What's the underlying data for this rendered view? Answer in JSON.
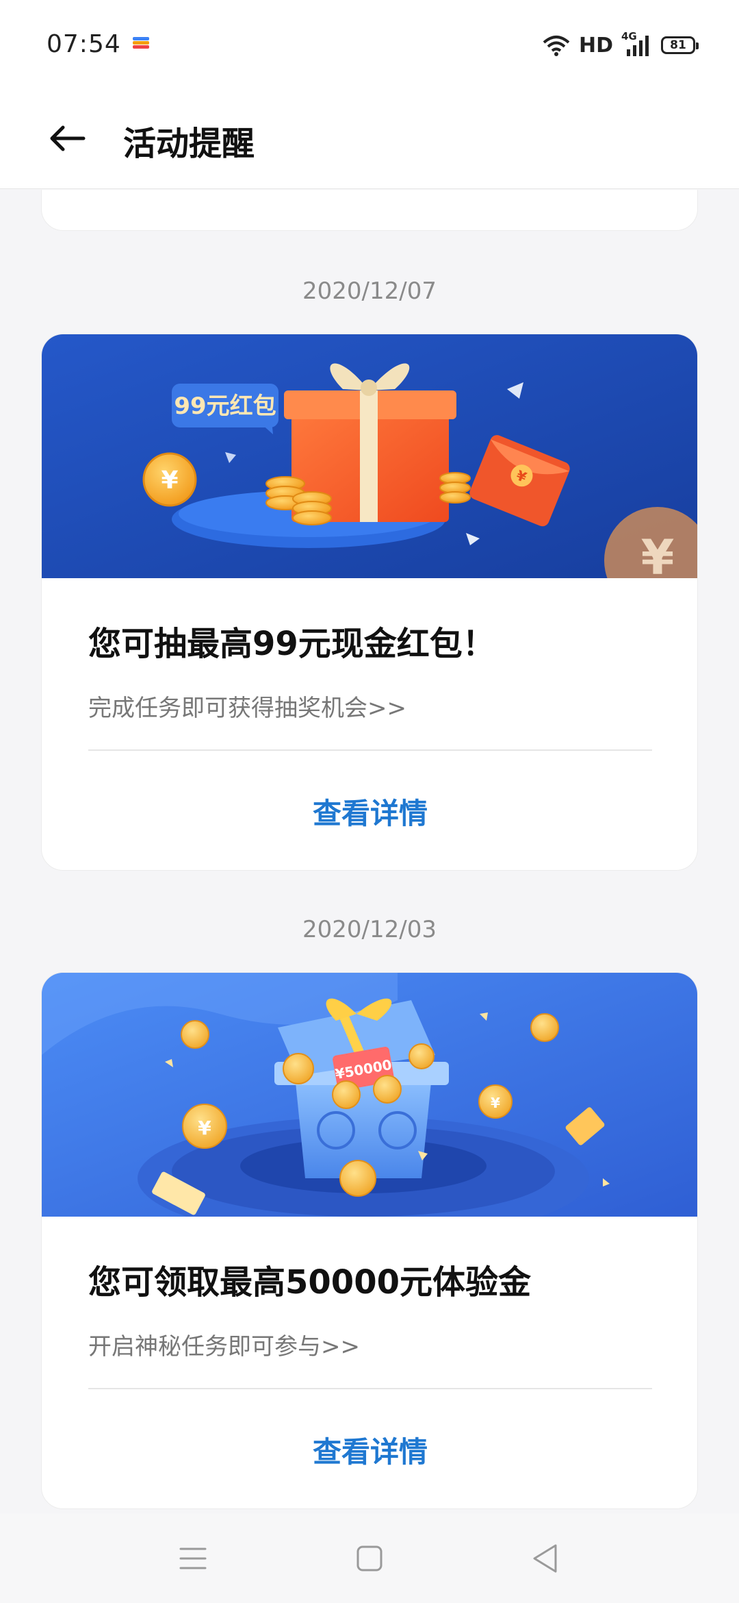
{
  "status_bar": {
    "time": "07:54",
    "network_label": "HD",
    "cell_label": "4G",
    "battery_level": "81"
  },
  "header": {
    "title": "活动提醒",
    "back_icon": "arrow-left-icon"
  },
  "feed": [
    {
      "date": "2020/12/07",
      "banner_tag": "99元红包",
      "title": "您可抽最高99元现金红包！",
      "subtitle": "完成任务即可获得抽奖机会>>",
      "action_label": "查看详情"
    },
    {
      "date": "2020/12/03",
      "banner_tag": "¥50000",
      "title": "您可领取最高50000元体验金",
      "subtitle": "开启神秘任务即可参与>>",
      "action_label": "查看详情"
    }
  ],
  "colors": {
    "accent": "#1f78d1",
    "banner1_bg": "#1e4fb8",
    "banner2_bg": "#3f7ae8"
  },
  "nav_bar": {
    "icons": [
      "menu-icon",
      "home-square-icon",
      "back-triangle-icon"
    ]
  }
}
